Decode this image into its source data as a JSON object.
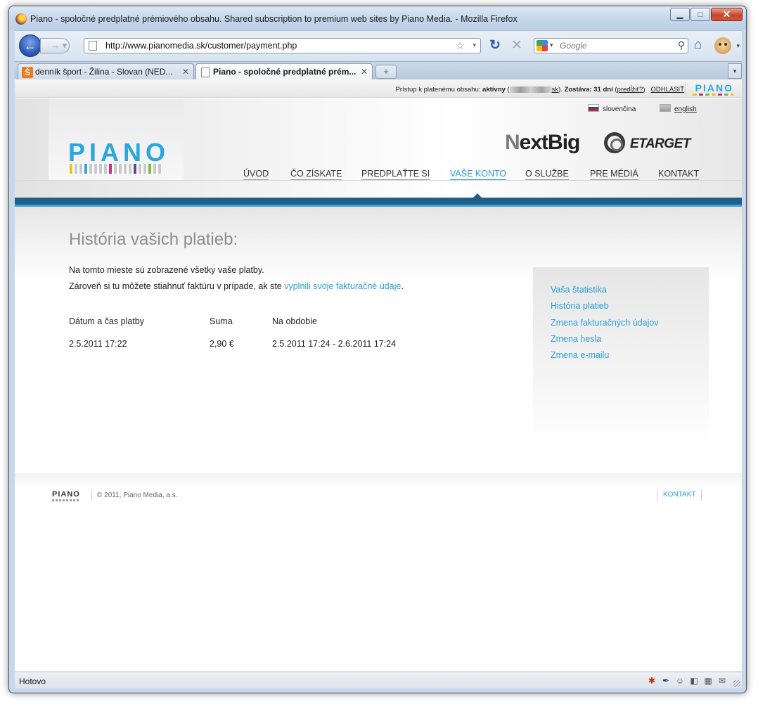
{
  "window": {
    "title": "Piano - spoločné predplatné prémiového obsahu. Shared subscription to premium web sites by Piano Media. - Mozilla Firefox",
    "buttons": {
      "minimize": "▁",
      "maximize": "□",
      "close": "✕"
    }
  },
  "toolbar": {
    "url": "http://www.pianomedia.sk/customer/payment.php",
    "search_placeholder": "Google",
    "icons": [
      "back-icon",
      "forward-icon",
      "page-icon",
      "bookmark-star-icon",
      "reload-icon",
      "stop-icon",
      "google-icon",
      "search-icon",
      "home-icon",
      "addon-face-icon"
    ]
  },
  "tabs": [
    {
      "label": "denník šport - Žilina - Slovan (NED...",
      "favicon": "Š",
      "active": false
    },
    {
      "label": "Piano - spoločné predplatné prém...",
      "active": true
    }
  ],
  "newtab_label": "+",
  "site": {
    "topbar": {
      "access_label": "Prístup k platenému obsahu:",
      "access_status": "aktívny",
      "account_suffix": "sk",
      "remaining_label": "Zostáva: 31 dní",
      "extend_link": "predĺžiť?",
      "logout": "ODHLÁSIŤ",
      "logo": "PIANO"
    },
    "languages": {
      "sk": "slovenčina",
      "en": "english"
    },
    "logo": "PIANO",
    "partners": {
      "nextbig_first": "N",
      "nextbig_rest": "extBig",
      "etarget": "ETARGET"
    },
    "nav": [
      "ÚVOD",
      "ČO ZÍSKATE",
      "PREDPLAŤTE SI",
      "VAŠE KONTO",
      "O SLUŽBE",
      "PRE MÉDIÁ",
      "KONTAKT"
    ],
    "nav_active": "VAŠE KONTO",
    "accent_color": "#2a9fd6",
    "band_color": "#1f5f8a"
  },
  "page": {
    "heading": "História vašich platieb:",
    "intro_line1": "Na tomto mieste sú zobrazené všetky vaše platby.",
    "intro_line2_prefix": "Zároveň si tu môžete stiahnuť faktúru v prípade, ak ste ",
    "intro_line2_link": "vyplnili svoje fakturačné údaje",
    "intro_line2_suffix": ".",
    "table": {
      "headers": [
        "Dátum a čas platby",
        "Suma",
        "Na obdobie"
      ],
      "rows": [
        [
          "2.5.2011 17:22",
          "2,90 €",
          "2.5.2011 17:24 - 2.6.2011 17:24"
        ]
      ]
    },
    "sidebar_links": [
      "Vaša štatistika",
      "História platieb",
      "Zmena fakturačných údajov",
      "Zmena hesla",
      "Zmena e-mailu"
    ]
  },
  "footer": {
    "logo": "PIANO",
    "copyright": "© 2011, Piano Media, a.s.",
    "contact": "KONTAKT"
  },
  "statusbar": {
    "text": "Hotovo"
  }
}
